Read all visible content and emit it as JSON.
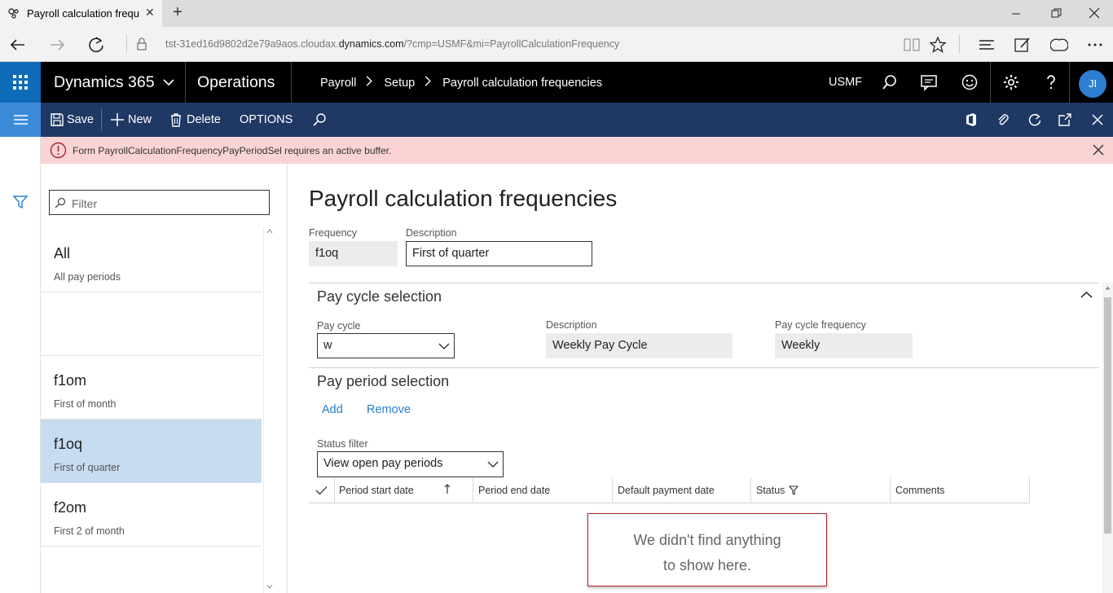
{
  "browser": {
    "tab_title": "Payroll calculation frequ",
    "new_tab_glyph": "+",
    "url_prefix": "tst-31ed16d9802d2e79a9aos.cloudax.",
    "url_host": "dynamics.com",
    "url_suffix": "/?cmp=USMF&mi=PayrollCalculationFrequency"
  },
  "topbar": {
    "brand": "Dynamics 365",
    "module": "Operations",
    "breadcrumbs": [
      "Payroll",
      "Setup",
      "Payroll calculation frequencies"
    ],
    "company": "USMF",
    "user_initials": "JI"
  },
  "actions": {
    "save": "Save",
    "new": "New",
    "delete": "Delete",
    "options": "OPTIONS"
  },
  "error": {
    "message": "Form PayrollCalculationFrequencyPayPeriodSel requires an active buffer."
  },
  "list": {
    "filter_placeholder": "Filter",
    "items": [
      {
        "title": "All",
        "subtitle": "All pay periods",
        "selected": false
      },
      {
        "title": "",
        "subtitle": "",
        "selected": false
      },
      {
        "title": "f1om",
        "subtitle": "First of month",
        "selected": false
      },
      {
        "title": "f1oq",
        "subtitle": "First of quarter",
        "selected": true
      },
      {
        "title": "f2om",
        "subtitle": "First 2 of month",
        "selected": false
      }
    ]
  },
  "details": {
    "page_title": "Payroll calculation frequencies",
    "frequency_label": "Frequency",
    "frequency_value": "f1oq",
    "description_label": "Description",
    "description_value": "First of quarter",
    "pay_cycle_section": {
      "title": "Pay cycle selection",
      "pay_cycle_label": "Pay cycle",
      "pay_cycle_value": "w",
      "description_label": "Description",
      "description_value": "Weekly Pay Cycle",
      "frequency_label": "Pay cycle frequency",
      "frequency_value": "Weekly"
    },
    "pay_period_section": {
      "title": "Pay period selection",
      "add": "Add",
      "remove": "Remove",
      "status_filter_label": "Status filter",
      "status_filter_value": "View open pay periods",
      "columns": [
        "Period start date",
        "Period end date",
        "Default payment date",
        "Status",
        "Comments"
      ],
      "empty_line1": "We didn't find anything",
      "empty_line2": "to show here."
    }
  },
  "colors": {
    "waffle": "#0e6bb8",
    "action_bar": "#1f3864",
    "selected_row": "#c7dcf0",
    "error_bar": "#fad4d4",
    "link": "#2a7ec9"
  }
}
